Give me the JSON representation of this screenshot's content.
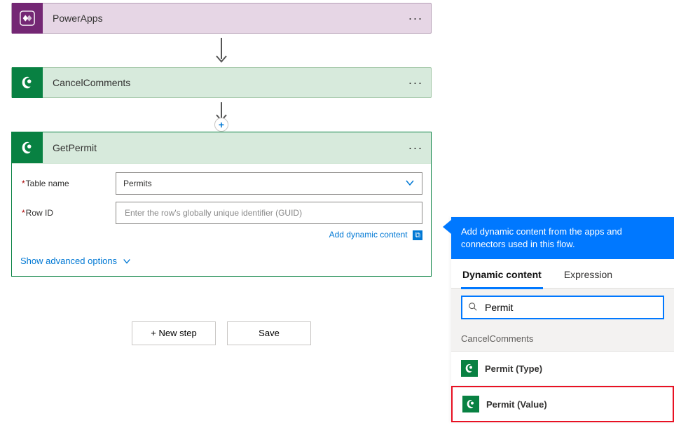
{
  "steps": {
    "powerapps": {
      "label": "PowerApps"
    },
    "cancelcomments": {
      "label": "CancelComments"
    },
    "getpermit": {
      "label": "GetPermit",
      "fields": {
        "table_label": "Table name",
        "table_value": "Permits",
        "rowid_label": "Row ID",
        "rowid_placeholder": "Enter the row's globally unique identifier (GUID)"
      },
      "add_dynamic_link": "Add dynamic content",
      "advanced_options": "Show advanced options"
    }
  },
  "footer": {
    "new_step": "+ New step",
    "save": "Save"
  },
  "dyn_panel": {
    "heading": "Add dynamic content from the apps and connectors used in this flow.",
    "tabs": {
      "dynamic": "Dynamic content",
      "expression": "Expression"
    },
    "search_value": "Permit",
    "section": "CancelComments",
    "items": {
      "type": "Permit (Type)",
      "value": "Permit (Value)"
    }
  }
}
